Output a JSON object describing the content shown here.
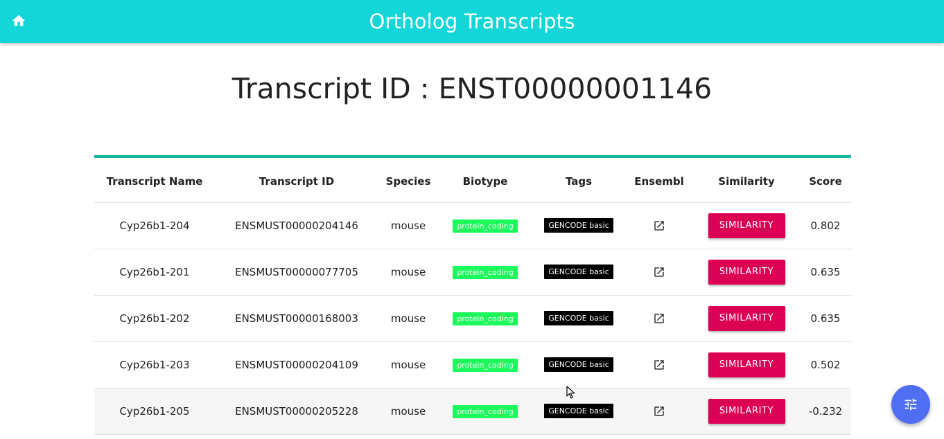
{
  "appbar": {
    "title": "Ortholog Transcripts",
    "home_icon": "home-icon",
    "color": "#12d6d8"
  },
  "page": {
    "title": "Transcript ID : ENST00000001146"
  },
  "table": {
    "headers": [
      "Transcript Name",
      "Transcript ID",
      "Species",
      "Biotype",
      "Tags",
      "Ensembl",
      "Similarity",
      "Score"
    ],
    "rows": [
      {
        "name": "Cyp26b1-204",
        "id": "ENSMUST00000204146",
        "species": "mouse",
        "biotype": "protein_coding",
        "tag": "GENCODE basic",
        "similarity_label": "SIMILARITY",
        "score": "0.802"
      },
      {
        "name": "Cyp26b1-201",
        "id": "ENSMUST00000077705",
        "species": "mouse",
        "biotype": "protein_coding",
        "tag": "GENCODE basic",
        "similarity_label": "SIMILARITY",
        "score": "0.635"
      },
      {
        "name": "Cyp26b1-202",
        "id": "ENSMUST00000168003",
        "species": "mouse",
        "biotype": "protein_coding",
        "tag": "GENCODE basic",
        "similarity_label": "SIMILARITY",
        "score": "0.635"
      },
      {
        "name": "Cyp26b1-203",
        "id": "ENSMUST00000204109",
        "species": "mouse",
        "biotype": "protein_coding",
        "tag": "GENCODE basic",
        "similarity_label": "SIMILARITY",
        "score": "0.502"
      },
      {
        "name": "Cyp26b1-205",
        "id": "ENSMUST00000205228",
        "species": "mouse",
        "biotype": "protein_coding",
        "tag": "GENCODE basic",
        "similarity_label": "SIMILARITY",
        "score": "-0.232"
      }
    ]
  },
  "colors": {
    "accent_border": "#17b7a6",
    "biotype_tag": "#1cf95b",
    "gencode_tag": "#000000",
    "similarity_button": "#dc0055",
    "fab": "#4f6ef2"
  },
  "fab": {
    "icon": "tune-icon"
  }
}
